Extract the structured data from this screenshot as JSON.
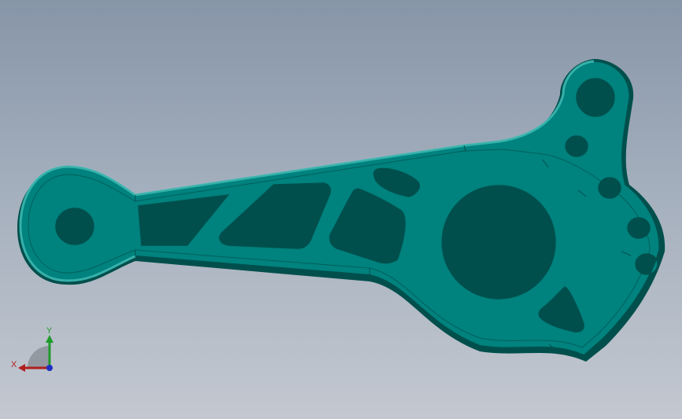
{
  "viewport": {
    "background_top": "#8795a8",
    "background_bottom": "#c3c8d0",
    "part_color": "#00827e",
    "part_edge_color": "#00504d",
    "part_highlight_color": "#2fb3ad"
  },
  "triad": {
    "x_label": "X",
    "y_label": "Y",
    "x_color": "#b01e1e",
    "y_color": "#1f9a2a",
    "z_color": "#1d2fc4"
  }
}
